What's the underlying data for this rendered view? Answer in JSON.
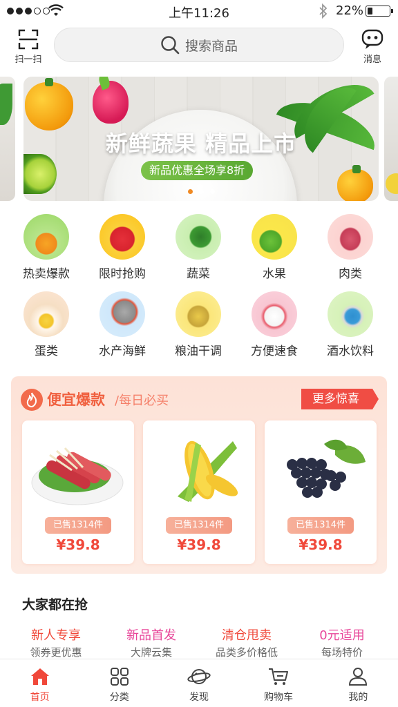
{
  "status_bar": {
    "time": "上午11:26",
    "battery": "22%",
    "battery_level": 0.22
  },
  "header": {
    "scan_label": "扫一扫",
    "search_placeholder": "搜索商品",
    "message_label": "消息"
  },
  "banner": {
    "headline": "新鲜蔬果 精品上市",
    "tagline": "新品优惠全场享8折",
    "slide_count": 3,
    "active_slide": 1
  },
  "categories": [
    {
      "label": "热卖爆款",
      "icon": "hot-sale-icon"
    },
    {
      "label": "限时抢购",
      "icon": "flash-sale-icon"
    },
    {
      "label": "蔬菜",
      "icon": "vegetables-icon"
    },
    {
      "label": "水果",
      "icon": "fruit-icon"
    },
    {
      "label": "肉类",
      "icon": "meat-icon"
    },
    {
      "label": "蛋类",
      "icon": "eggs-icon"
    },
    {
      "label": "水产海鲜",
      "icon": "seafood-icon"
    },
    {
      "label": "粮油干调",
      "icon": "grain-oil-icon"
    },
    {
      "label": "方便速食",
      "icon": "instant-food-icon"
    },
    {
      "label": "酒水饮料",
      "icon": "drinks-icon"
    }
  ],
  "deals": {
    "title": "便宜爆款",
    "subtitle": "/每日必买",
    "more": "更多惊喜",
    "items": [
      {
        "image": "beef-rolls",
        "sold": "已售1314件",
        "price": "¥39.8"
      },
      {
        "image": "corn",
        "sold": "已售1314件",
        "price": "¥39.8"
      },
      {
        "image": "grapes",
        "sold": "已售1314件",
        "price": "¥39.8"
      }
    ]
  },
  "grab": {
    "title": "大家都在抢",
    "promos": [
      {
        "title": "新人专享",
        "subtitle": "领券更优惠",
        "color": "#f0483a"
      },
      {
        "title": "新品首发",
        "subtitle": "大牌云集",
        "color": "#e8479a"
      },
      {
        "title": "清仓甩卖",
        "subtitle": "品类多价格低",
        "color": "#f0483a"
      },
      {
        "title": "0元适用",
        "subtitle": "每场特价",
        "color": "#e8479a"
      }
    ]
  },
  "tabbar": [
    {
      "label": "首页",
      "icon": "home-icon",
      "active": true
    },
    {
      "label": "分类",
      "icon": "category-grid-icon",
      "active": false
    },
    {
      "label": "发现",
      "icon": "discover-planet-icon",
      "active": false
    },
    {
      "label": "购物车",
      "icon": "cart-icon",
      "active": false
    },
    {
      "label": "我的",
      "icon": "profile-icon",
      "active": false
    }
  ],
  "colors": {
    "accent": "#f0483a",
    "pink": "#e8479a",
    "deal_bg": "#fde2d7",
    "green": "#59a832"
  }
}
